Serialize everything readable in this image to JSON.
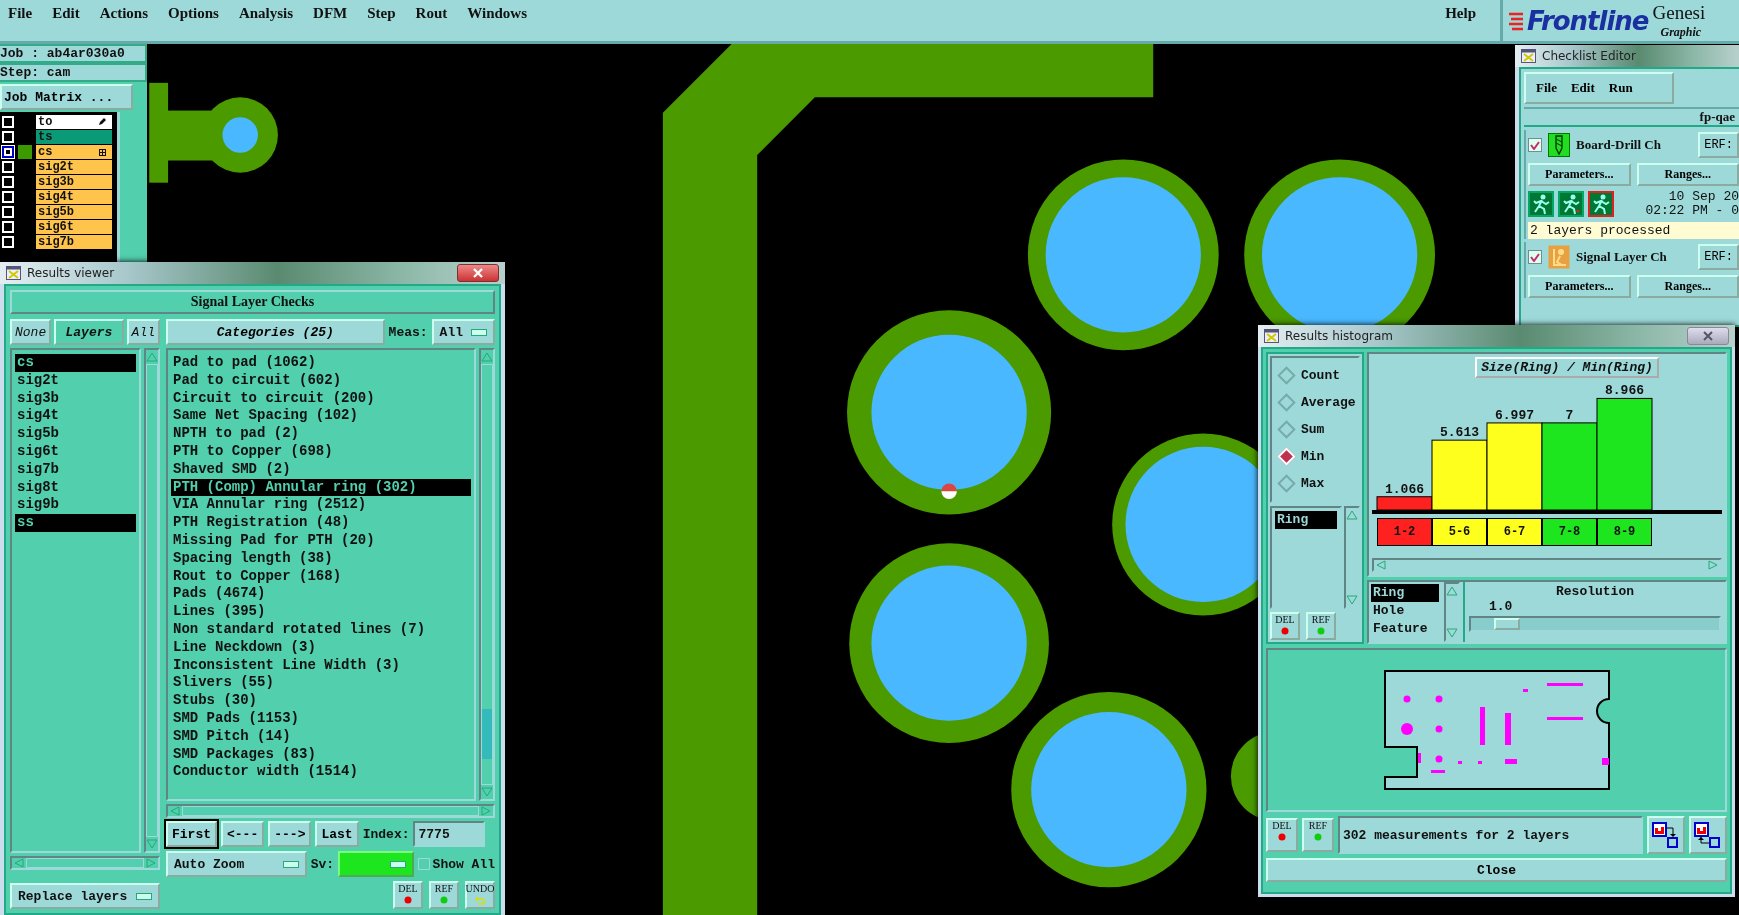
{
  "menu_bar": {
    "items": [
      "File",
      "Edit",
      "Actions",
      "Options",
      "Analysis",
      "DFM",
      "Step",
      "Rout",
      "Windows"
    ],
    "help": "Help"
  },
  "logo": {
    "brand": "Frontline",
    "product": "Genesi",
    "tagline": "Graphic"
  },
  "job_panel": {
    "job": "Job : ab4ar030a0",
    "step": "Step: cam",
    "job_matrix_button": "Job Matrix ...",
    "layers": [
      {
        "name": "to",
        "color": "#ffffff",
        "selected": false,
        "kind": "edit"
      },
      {
        "name": "ts",
        "color": "#0a9a78",
        "selected": false,
        "kind": "plain"
      },
      {
        "name": "cs",
        "color": "#ffc44c",
        "selected": true,
        "kind": "grid"
      },
      {
        "name": "sig2t",
        "color": "#ffc44c",
        "selected": false,
        "kind": "plain"
      },
      {
        "name": "sig3b",
        "color": "#ffc44c",
        "selected": false,
        "kind": "plain"
      },
      {
        "name": "sig4t",
        "color": "#ffc44c",
        "selected": false,
        "kind": "plain"
      },
      {
        "name": "sig5b",
        "color": "#ffc44c",
        "selected": false,
        "kind": "plain"
      },
      {
        "name": "sig6t",
        "color": "#ffc44c",
        "selected": false,
        "kind": "plain"
      },
      {
        "name": "sig7b",
        "color": "#ffc44c",
        "selected": false,
        "kind": "plain"
      }
    ]
  },
  "results_viewer": {
    "title": "Results viewer",
    "heading": "Signal Layer Checks",
    "layer_buttons": [
      "None",
      "Layers",
      "All"
    ],
    "layers": [
      {
        "name": "cs",
        "selected": true
      },
      {
        "name": "sig2t",
        "selected": false
      },
      {
        "name": "sig3b",
        "selected": false
      },
      {
        "name": "sig4t",
        "selected": false
      },
      {
        "name": "sig5b",
        "selected": false
      },
      {
        "name": "sig6t",
        "selected": false
      },
      {
        "name": "sig7b",
        "selected": false
      },
      {
        "name": "sig8t",
        "selected": false
      },
      {
        "name": "sig9b",
        "selected": false
      },
      {
        "name": "ss",
        "selected": true
      }
    ],
    "replace_mode": "Replace layers",
    "categories_button": "Categories (25)",
    "meas_label": "Meas:",
    "meas_value": "All",
    "categories": [
      {
        "label": "Pad to pad (1062)",
        "selected": false
      },
      {
        "label": "Pad to circuit (602)",
        "selected": false
      },
      {
        "label": "Circuit to circuit (200)",
        "selected": false
      },
      {
        "label": "Same Net Spacing (102)",
        "selected": false
      },
      {
        "label": "NPTH to pad (2)",
        "selected": false
      },
      {
        "label": "PTH to Copper (698)",
        "selected": false
      },
      {
        "label": "Shaved SMD (2)",
        "selected": false
      },
      {
        "label": "PTH (Comp) Annular ring (302)",
        "selected": true
      },
      {
        "label": "VIA Annular ring (2512)",
        "selected": false
      },
      {
        "label": "PTH Registration (48)",
        "selected": false
      },
      {
        "label": "Missing Pad for PTH (20)",
        "selected": false
      },
      {
        "label": "Spacing length (38)",
        "selected": false
      },
      {
        "label": "Rout to Copper (168)",
        "selected": false
      },
      {
        "label": "Pads (4674)",
        "selected": false
      },
      {
        "label": "Lines (395)",
        "selected": false
      },
      {
        "label": "Non standard rotated lines (7)",
        "selected": false
      },
      {
        "label": "Line Neckdown (3)",
        "selected": false
      },
      {
        "label": "Inconsistent Line Width (3)",
        "selected": false
      },
      {
        "label": "Slivers (55)",
        "selected": false
      },
      {
        "label": "Stubs (30)",
        "selected": false
      },
      {
        "label": "SMD Pads (1153)",
        "selected": false
      },
      {
        "label": "SMD Pitch (14)",
        "selected": false
      },
      {
        "label": "SMD Packages (83)",
        "selected": false
      },
      {
        "label": "Conductor width (1514)",
        "selected": false
      }
    ],
    "nav_buttons": [
      {
        "label": "First",
        "default": true
      },
      {
        "label": "<---",
        "default": false
      },
      {
        "label": "--->",
        "default": false
      },
      {
        "label": "Last",
        "default": false
      }
    ],
    "index_label": "Index:",
    "index_value": "7775",
    "zoom_mode": "Auto Zoom",
    "sv_label": "Sv:",
    "show_all": {
      "label": "Show All",
      "checked": false
    },
    "tool_buttons": [
      {
        "label": "DEL",
        "kind": "delete"
      },
      {
        "label": "REF",
        "kind": "refresh"
      },
      {
        "label": "UNDO",
        "kind": "undo"
      }
    ]
  },
  "checklist_editor": {
    "title": "Checklist Editor",
    "menu": [
      "File",
      "Edit",
      "Run"
    ],
    "checklist_name": "fp-qae",
    "checks": [
      {
        "name": "Board-Drill Ch",
        "kind": "drill",
        "checked": true,
        "erf_label": "ERF:",
        "buttons": [
          "Parameters...",
          "Ranges..."
        ],
        "date": "10 Sep 20",
        "time": "02:22 PM - 0",
        "status": "2 layers processed"
      },
      {
        "name": "Signal Layer Ch",
        "kind": "signal",
        "checked": true,
        "erf_label": "ERF:",
        "buttons": [
          "Parameters...",
          "Ranges..."
        ]
      }
    ]
  },
  "histogram": {
    "title": "Results histogram",
    "modes": [
      {
        "label": "Count",
        "selected": false
      },
      {
        "label": "Average",
        "selected": false
      },
      {
        "label": "Sum",
        "selected": false
      },
      {
        "label": "Min",
        "selected": true
      },
      {
        "label": "Max",
        "selected": false
      }
    ],
    "measures": [
      {
        "label": "Ring",
        "selected": true
      }
    ],
    "tool_buttons": [
      {
        "label": "DEL",
        "kind": "delete"
      },
      {
        "label": "REF",
        "kind": "refresh"
      }
    ],
    "chart_data": {
      "type": "bar",
      "title": "Size(Ring) / Min(Ring)",
      "categories": [
        "1-2",
        "5-6",
        "6-7",
        "7-8",
        "8-9"
      ],
      "values": [
        1.066,
        5.613,
        6.997,
        7,
        8.966
      ],
      "data_labels": true
    },
    "bins": [
      {
        "color": "#ff2020"
      },
      {
        "color": "#ffff1e"
      },
      {
        "color": "#ffff1e"
      },
      {
        "color": "#1ee61e"
      },
      {
        "color": "#1ee61e"
      }
    ],
    "features": [
      {
        "label": "Ring",
        "selected": true
      },
      {
        "label": "Hole",
        "selected": false
      },
      {
        "label": "Feature",
        "selected": false
      }
    ],
    "resolution": {
      "label": "Resolution",
      "value": "1.0",
      "level": 0.1
    },
    "bottom_tool_buttons": [
      {
        "label": "DEL",
        "kind": "delete"
      },
      {
        "label": "REF",
        "kind": "refresh"
      }
    ],
    "status": "302 measurements for 2 layers",
    "close_button": "Close"
  }
}
